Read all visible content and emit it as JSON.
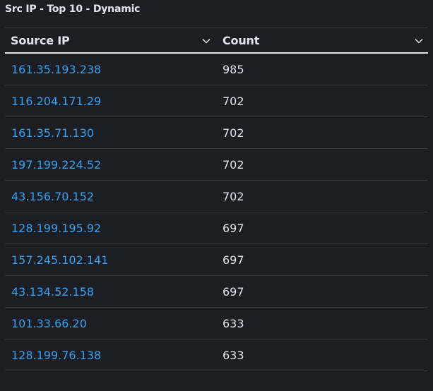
{
  "panel": {
    "title": "Src IP - Top 10 - Dynamic"
  },
  "table": {
    "columns": [
      {
        "label": "Source IP",
        "icon": "chevron-down-icon"
      },
      {
        "label": "Count",
        "icon": "chevron-down-icon"
      }
    ],
    "rows": [
      {
        "ip": "161.35.193.238",
        "count": "985"
      },
      {
        "ip": "116.204.171.29",
        "count": "702"
      },
      {
        "ip": "161.35.71.130",
        "count": "702"
      },
      {
        "ip": "197.199.224.52",
        "count": "702"
      },
      {
        "ip": "43.156.70.152",
        "count": "702"
      },
      {
        "ip": "128.199.195.92",
        "count": "697"
      },
      {
        "ip": "157.245.102.141",
        "count": "697"
      },
      {
        "ip": "43.134.52.158",
        "count": "697"
      },
      {
        "ip": "101.33.66.20",
        "count": "633"
      },
      {
        "ip": "128.199.76.138",
        "count": "633"
      }
    ]
  },
  "colors": {
    "background": "#1d1e24",
    "link": "#36a2ef",
    "text": "#dfe5ef",
    "divider": "#343741"
  }
}
